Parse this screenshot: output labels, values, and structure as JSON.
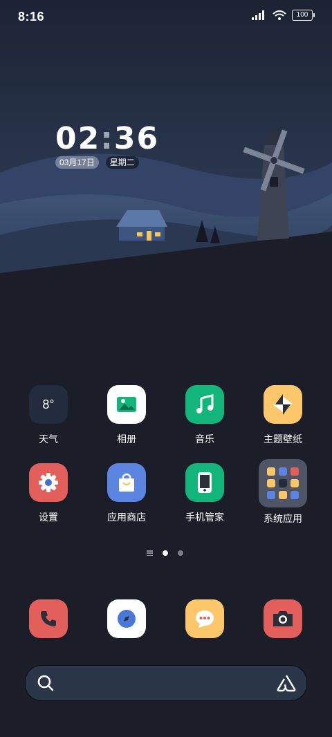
{
  "status": {
    "time": "8:16",
    "battery": "100"
  },
  "clock": {
    "hour": "02",
    "minute": "36",
    "date": "03月17日",
    "weekday": "星期二"
  },
  "apps": [
    {
      "name": "weather",
      "label": "天气",
      "icon_text": "8°",
      "color": "#232c3d"
    },
    {
      "name": "gallery",
      "label": "相册",
      "color": "#ffffff"
    },
    {
      "name": "music",
      "label": "音乐",
      "color": "#13b67a"
    },
    {
      "name": "themes",
      "label": "主题壁纸",
      "color": "#fbc76a"
    },
    {
      "name": "settings",
      "label": "设置",
      "color": "#e35f5c"
    },
    {
      "name": "app-store",
      "label": "应用商店",
      "color": "#5b85e0"
    },
    {
      "name": "phone-manager",
      "label": "手机管家",
      "color": "#13b67a"
    },
    {
      "name": "system-apps",
      "label": "系统应用",
      "color": "#5a6070"
    }
  ],
  "dock": [
    {
      "name": "phone",
      "icon": "phone-icon",
      "color": "#e35f5c"
    },
    {
      "name": "browser",
      "icon": "compass-icon",
      "color": "#ffffff"
    },
    {
      "name": "messages",
      "icon": "chat-icon",
      "color": "#fbc76a"
    },
    {
      "name": "camera",
      "icon": "camera-icon",
      "color": "#e35f5c"
    }
  ],
  "page_indicator": {
    "pages": 2,
    "active": 1
  }
}
